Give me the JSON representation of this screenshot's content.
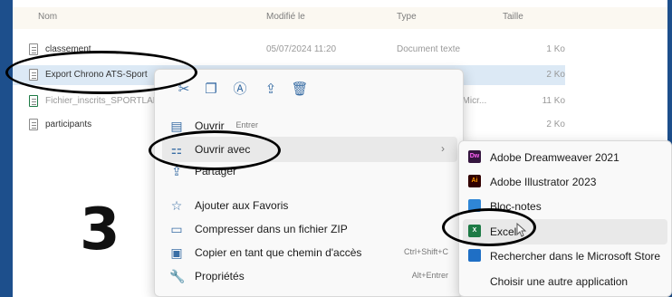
{
  "columns": {
    "name": "Nom",
    "modified": "Modifié le",
    "type": "Type",
    "size": "Taille"
  },
  "files": [
    {
      "name": "classement",
      "modified": "05/07/2024 11:20",
      "type": "Document texte",
      "size": "1 Ko"
    },
    {
      "name": "Export Chrono ATS-Sport",
      "modified": "",
      "type": "te",
      "size": "2 Ko"
    },
    {
      "name": "Fichier_inscrits_SPORTLAB",
      "modified": "",
      "type": "ul Micr...",
      "size": "11 Ko"
    },
    {
      "name": "participants",
      "modified": "",
      "type": "te",
      "size": "2 Ko"
    }
  ],
  "context_menu": {
    "toolbar_icons": [
      "cut-icon",
      "copy-icon",
      "rename-icon",
      "share-icon",
      "delete-icon"
    ],
    "items": [
      {
        "label": "Ouvrir",
        "shortcut": "Entrer",
        "icon": "open-icon"
      },
      {
        "label": "Ouvrir avec",
        "shortcut": "",
        "icon": "open-with-icon"
      },
      {
        "label": "Partager",
        "shortcut": "",
        "icon": "share-icon"
      },
      {
        "label": "Ajouter aux Favoris",
        "shortcut": "",
        "icon": "star-icon"
      },
      {
        "label": "Compresser dans un fichier ZIP",
        "shortcut": "",
        "icon": "zip-icon"
      },
      {
        "label": "Copier en tant que chemin d'accès",
        "shortcut": "Ctrl+Shift+C",
        "icon": "path-icon"
      },
      {
        "label": "Propriétés",
        "shortcut": "Alt+Entrer",
        "icon": "wrench-icon"
      }
    ]
  },
  "submenu": {
    "items": [
      {
        "label": "Adobe Dreamweaver 2021",
        "abbr": "Dw",
        "color": "#35163f"
      },
      {
        "label": "Adobe Illustrator 2023",
        "abbr": "Ai",
        "color": "#310000"
      },
      {
        "label": "Bloc-notes",
        "abbr": "",
        "color": "#2f86d6"
      },
      {
        "label": "Excel",
        "abbr": "",
        "color": "#1d7a45"
      },
      {
        "label": "Rechercher dans le Microsoft Store",
        "abbr": "",
        "color": "#1f6fc5"
      },
      {
        "label": "Choisir une autre application",
        "abbr": "",
        "color": ""
      }
    ]
  },
  "step_number": "3",
  "colors": {
    "frame": "#1d4f8c",
    "selected_row": "#dce9f5",
    "accent": "#3a6ea5"
  }
}
